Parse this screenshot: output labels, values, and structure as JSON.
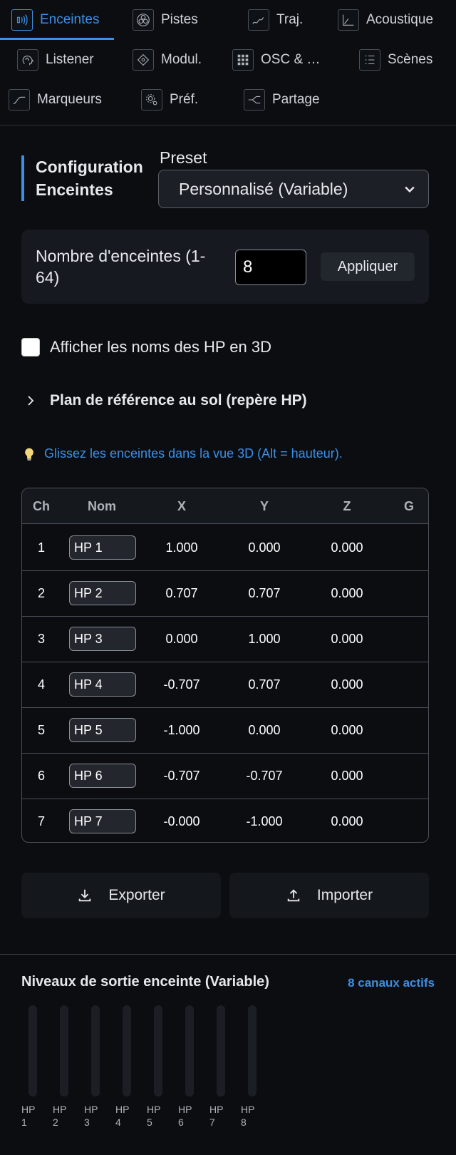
{
  "tabs": [
    {
      "label": "Enceintes",
      "icon": "speaker-waves-icon",
      "active": true
    },
    {
      "label": "Pistes",
      "icon": "tracks-circle-icon",
      "active": false
    },
    {
      "label": "Traj.",
      "icon": "trajectory-icon",
      "active": false
    },
    {
      "label": "Acoustique",
      "icon": "acoustics-chart-icon",
      "active": false
    },
    {
      "label": "Listener",
      "icon": "listener-head-icon",
      "active": false
    },
    {
      "label": "Modul.",
      "icon": "modulation-icon",
      "active": false
    },
    {
      "label": "OSC & …",
      "icon": "osc-grid-icon",
      "active": false
    },
    {
      "label": "Scènes",
      "icon": "scenes-list-icon",
      "active": false
    },
    {
      "label": "Marqueurs",
      "icon": "markers-curve-icon",
      "active": false
    },
    {
      "label": "Préf.",
      "icon": "preferences-gear-icon",
      "active": false
    },
    {
      "label": "Partage",
      "icon": "share-icon",
      "active": false
    }
  ],
  "config": {
    "title": "Configuration Enceintes",
    "preset_label": "Preset",
    "preset_value": "Personnalisé (Variable)",
    "count_label": "Nombre d'enceintes (1-64)",
    "count_value": "8",
    "apply_label": "Appliquer",
    "show_names_label": "Afficher les noms des HP en 3D",
    "show_names_checked": false,
    "ground_plane_label": "Plan de référence au sol (repère HP)",
    "hint": "Glissez les enceintes dans la vue 3D (Alt = hauteur)."
  },
  "table": {
    "headers": [
      "Ch",
      "Nom",
      "X",
      "Y",
      "Z",
      "G"
    ],
    "rows": [
      {
        "ch": "1",
        "name": "HP 1",
        "x": "1.000",
        "y": "0.000",
        "z": "0.000"
      },
      {
        "ch": "2",
        "name": "HP 2",
        "x": "0.707",
        "y": "0.707",
        "z": "0.000"
      },
      {
        "ch": "3",
        "name": "HP 3",
        "x": "0.000",
        "y": "1.000",
        "z": "0.000"
      },
      {
        "ch": "4",
        "name": "HP 4",
        "x": "-0.707",
        "y": "0.707",
        "z": "0.000"
      },
      {
        "ch": "5",
        "name": "HP 5",
        "x": "-1.000",
        "y": "0.000",
        "z": "0.000"
      },
      {
        "ch": "6",
        "name": "HP 6",
        "x": "-0.707",
        "y": "-0.707",
        "z": "0.000"
      },
      {
        "ch": "7",
        "name": "HP 7",
        "x": "-0.000",
        "y": "-1.000",
        "z": "0.000"
      }
    ]
  },
  "actions": {
    "export_label": "Exporter",
    "import_label": "Importer"
  },
  "levels": {
    "title": "Niveaux de sortie enceinte (Variable)",
    "active_count": "8 canaux actifs",
    "meters": [
      "HP 1",
      "HP 2",
      "HP 3",
      "HP 4",
      "HP 5",
      "HP 6",
      "HP 7",
      "HP 8"
    ]
  },
  "colors": {
    "accent": "#3d8fe6",
    "background": "#0b0d11",
    "panel": "#16191f"
  }
}
